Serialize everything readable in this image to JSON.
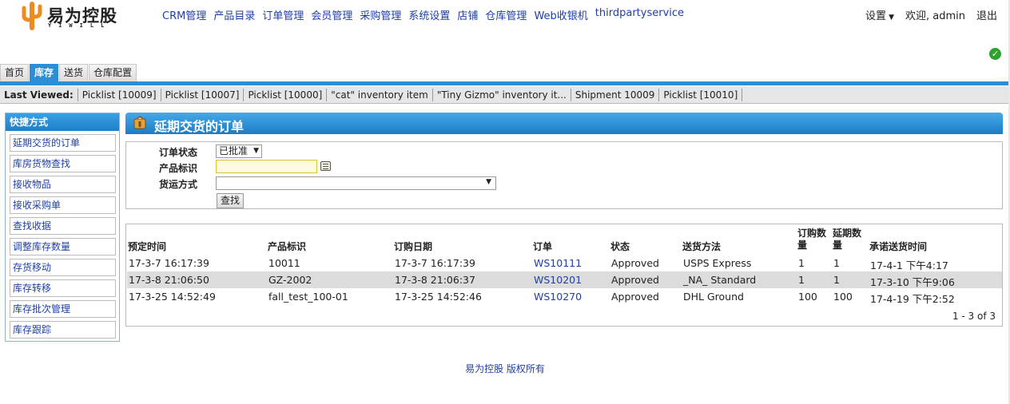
{
  "brand": {
    "name": "易为控股",
    "sub": "YIWILL"
  },
  "topnav": [
    "CRM管理",
    "产品目录",
    "订单管理",
    "会员管理",
    "采购管理",
    "系统设置",
    "店铺",
    "仓库管理",
    "Web收银机",
    "thirdpartyservice"
  ],
  "user": {
    "settings": "设置",
    "welcome": "欢迎, admin",
    "logout": "退出"
  },
  "tabs": [
    "首页",
    "库存",
    "送货",
    "仓库配置"
  ],
  "last_viewed": {
    "title": "Last Viewed:",
    "items": [
      "Picklist [10009]",
      "Picklist [10007]",
      "Picklist [10000]",
      "\"cat\" inventory item",
      "\"Tiny Gizmo\" inventory it...",
      "Shipment 10009",
      "Picklist [10010]"
    ]
  },
  "sidebar": {
    "title": "快捷方式",
    "items": [
      "延期交货的订单",
      "库房货物查找",
      "接收物品",
      "接收采购单",
      "查找收据",
      "调整库存数量",
      "存货移动",
      "库存转移",
      "库存批次管理",
      "库存跟踪"
    ]
  },
  "panel": {
    "title": "延期交货的订单"
  },
  "form": {
    "status_label": "订单状态",
    "status_value": "已批准",
    "product_label": "产品标识",
    "product_value": "",
    "shipping_label": "货运方式",
    "shipping_value": "",
    "search_button": "查找"
  },
  "table": {
    "headers": [
      "预定时间",
      "产品标识",
      "订购日期",
      "订单",
      "状态",
      "送货方法",
      "订购数量",
      "延期数量",
      "承诺送货时间"
    ],
    "rows": [
      [
        "17-3-7 16:17:39",
        "10011",
        "17-3-7 16:17:39",
        "WS10111",
        "Approved",
        "USPS Express",
        "1",
        "1",
        "17-4-1 下午4:17"
      ],
      [
        "17-3-8 21:06:50",
        "GZ-2002",
        "17-3-8 21:06:37",
        "WS10201",
        "Approved",
        "_NA_ Standard",
        "1",
        "1",
        "17-3-10 下午9:06"
      ],
      [
        "17-3-25 14:52:49",
        "fall_test_100-01",
        "17-3-25 14:52:46",
        "WS10270",
        "Approved",
        "DHL Ground",
        "100",
        "100",
        "17-4-19 下午2:52"
      ]
    ],
    "pager": "1 - 3 of 3"
  },
  "footer": "易为控股 版权所有",
  "colors": {
    "accent": "#2b8ed6",
    "link": "#1f3fa6",
    "logo": "#f08a1c",
    "ok": "#2ea12e"
  }
}
